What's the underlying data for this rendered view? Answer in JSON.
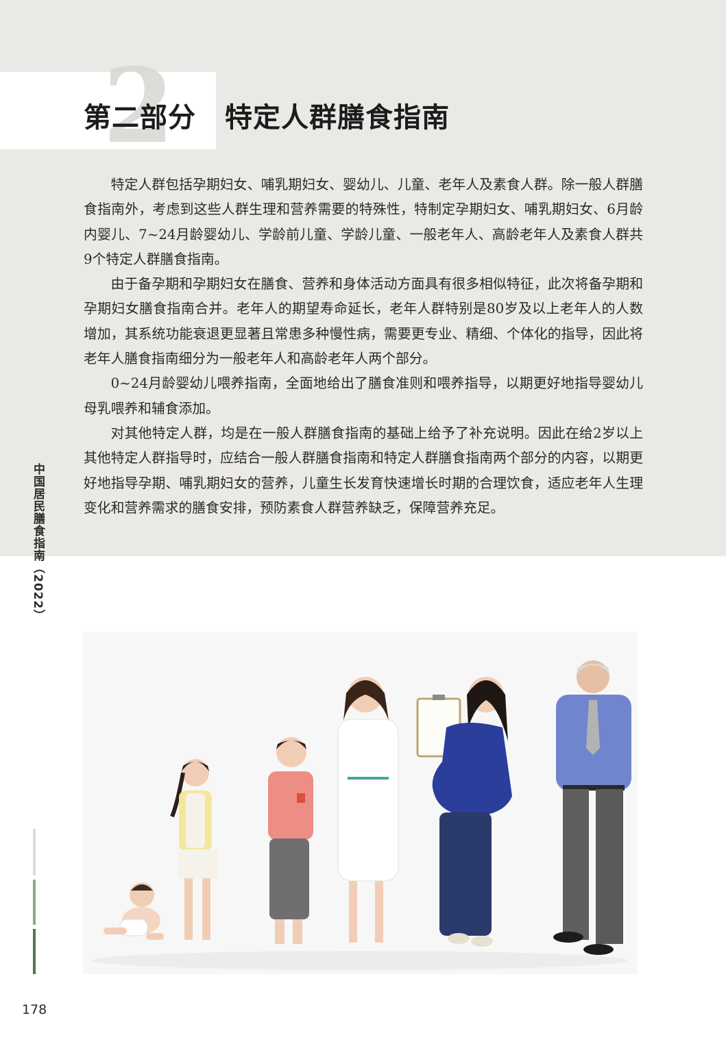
{
  "chapter": {
    "numeral": "2",
    "part_label": "第二部分",
    "title": "特定人群膳食指南"
  },
  "paragraphs": [
    "特定人群包括孕期妇女、哺乳期妇女、婴幼儿、儿童、老年人及素食人群。除一般人群膳食指南外，考虑到这些人群生理和营养需要的特殊性，特制定孕期妇女、哺乳期妇女、6月龄内婴儿、7~24月龄婴幼儿、学龄前儿童、学龄儿童、一般老年人、高龄老年人及素食人群共9个特定人群膳食指南。",
    "由于备孕期和孕期妇女在膳食、营养和身体活动方面具有很多相似特征，此次将备孕期和孕期妇女膳食指南合并。老年人的期望寿命延长，老年人群特别是80岁及以上老年人的人数增加，其系统功能衰退更显著且常患多种慢性病，需要更专业、精细、个体化的指导，因此将老年人膳食指南细分为一般老年人和高龄老年人两个部分。",
    "0~24月龄婴幼儿喂养指南，全面地给出了膳食准则和喂养指导，以期更好地指导婴幼儿母乳喂养和辅食添加。",
    "对其他特定人群，均是在一般人群膳食指南的基础上给予了补充说明。因此在给2岁以上其他特定人群指导时，应结合一般人群膳食指南和特定人群膳食指南两个部分的内容，以期更好地指导孕期、哺乳期妇女的营养，儿童生长发育快速增长时期的合理饮食，适应老年人生理变化和营养需求的膳食安排，预防素食人群营养缺乏，保障营养充足。"
  ],
  "side_label": "中国居民膳食指南（2022）",
  "page_number": "178",
  "colors": {
    "band": "#ebe9e6",
    "accent_light": "#d7e0d2",
    "accent_mid": "#8fa889",
    "accent_dark": "#4e7a4e"
  }
}
